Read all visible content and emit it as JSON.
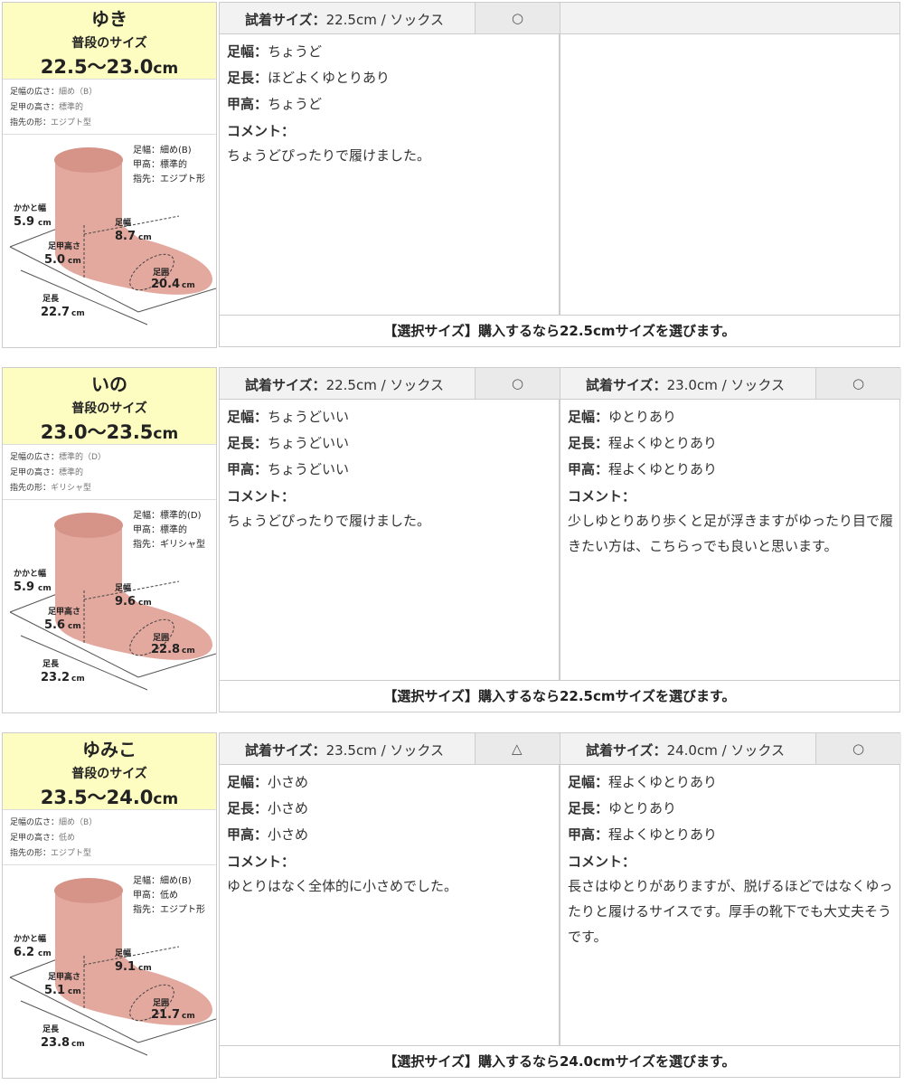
{
  "blocks": [
    {
      "name": "ゆき",
      "usual_label": "普段のサイズ",
      "range": "22.5〜23.0",
      "range_unit": "cm",
      "width_label": "足幅の広さ：",
      "width_val": "細め（B）",
      "instep_label": "足甲の高さ：",
      "instep_val": "標準的",
      "toe_label": "指先の形：",
      "toe_val": "エジプト型",
      "foot": {
        "note1": "足幅：細め(B)",
        "note2": "甲高：標準的",
        "note3": "指先：エジプト形",
        "heel_label": "かかと幅",
        "heel_val": "5.9",
        "width_label": "足幅",
        "width_val": "8.7",
        "instep_label": "足甲高さ",
        "instep_val": "5.0",
        "girth_label": "足囲",
        "girth_val": "20.4",
        "length_label": "足長",
        "length_val": "22.7",
        "unit": "cm"
      },
      "trials": [
        {
          "label": "試着サイズ：",
          "size": "22.5cm / ソックス",
          "mark": "○",
          "width": "ちょうど",
          "length": "ほどよくゆとりあり",
          "instep": "ちょうど",
          "comment": "ちょうどぴったりで履けました。"
        },
        {
          "label": "",
          "size": "",
          "mark": "",
          "width": "",
          "length": "",
          "instep": "",
          "comment": ""
        }
      ],
      "selection": "【選択サイズ】購入するなら22.5cmサイズを選びます。"
    },
    {
      "name": "いの",
      "usual_label": "普段のサイズ",
      "range": "23.0〜23.5",
      "range_unit": "cm",
      "width_label": "足幅の広さ：",
      "width_val": "標準的（D）",
      "instep_label": "足甲の高さ：",
      "instep_val": "標準的",
      "toe_label": "指先の形：",
      "toe_val": "ギリシャ型",
      "foot": {
        "note1": "足幅：標準的(D)",
        "note2": "甲高：標準的",
        "note3": "指先：ギリシャ型",
        "heel_label": "かかと幅",
        "heel_val": "5.9",
        "width_label": "足幅",
        "width_val": "9.6",
        "instep_label": "足甲高さ",
        "instep_val": "5.6",
        "girth_label": "足囲",
        "girth_val": "22.8",
        "length_label": "足長",
        "length_val": "23.2",
        "unit": "cm"
      },
      "trials": [
        {
          "label": "試着サイズ：",
          "size": "22.5cm / ソックス",
          "mark": "○",
          "width": "ちょうどいい",
          "length": "ちょうどいい",
          "instep": "ちょうどいい",
          "comment": "ちょうどぴったりで履けました。"
        },
        {
          "label": "試着サイズ：",
          "size": "23.0cm / ソックス",
          "mark": "○",
          "width": "ゆとりあり",
          "length": "程よくゆとりあり",
          "instep": "程よくゆとりあり",
          "comment": "少しゆとりあり歩くと足が浮きますがゆったり目で履きたい方は、こちらっでも良いと思います。"
        }
      ],
      "selection": "【選択サイズ】購入するなら22.5cmサイズを選びます。"
    },
    {
      "name": "ゆみこ",
      "usual_label": "普段のサイズ",
      "range": "23.5〜24.0",
      "range_unit": "cm",
      "width_label": "足幅の広さ：",
      "width_val": "細め（B）",
      "instep_label": "足甲の高さ：",
      "instep_val": "低め",
      "toe_label": "指先の形：",
      "toe_val": "エジプト型",
      "foot": {
        "note1": "足幅：細め(B)",
        "note2": "甲高：低め",
        "note3": "指先：エジプト形",
        "heel_label": "かかと幅",
        "heel_val": "6.2",
        "width_label": "足幅",
        "width_val": "9.1",
        "instep_label": "足甲高さ",
        "instep_val": "5.1",
        "girth_label": "足囲",
        "girth_val": "21.7",
        "length_label": "足長",
        "length_val": "23.8",
        "unit": "cm"
      },
      "trials": [
        {
          "label": "試着サイズ：",
          "size": "23.5cm / ソックス",
          "mark": "△",
          "width": "小さめ",
          "length": "小さめ",
          "instep": "小さめ",
          "comment": "ゆとりはなく全体的に小さめでした。"
        },
        {
          "label": "試着サイズ：",
          "size": "24.0cm / ソックス",
          "mark": "○",
          "width": "程よくゆとりあり",
          "length": "ゆとりあり",
          "instep": "程よくゆとりあり",
          "comment": "長さはゆとりがありますが、脱げるほどではなくゆったりと履けるサイスです。厚手の靴下でも大丈夫そうです。"
        }
      ],
      "selection": "【選択サイズ】購入するなら24.0cmサイズを選びます。"
    }
  ],
  "row_labels": {
    "width": "足幅：",
    "length": "足長：",
    "instep": "甲高：",
    "comment": "コメント："
  }
}
